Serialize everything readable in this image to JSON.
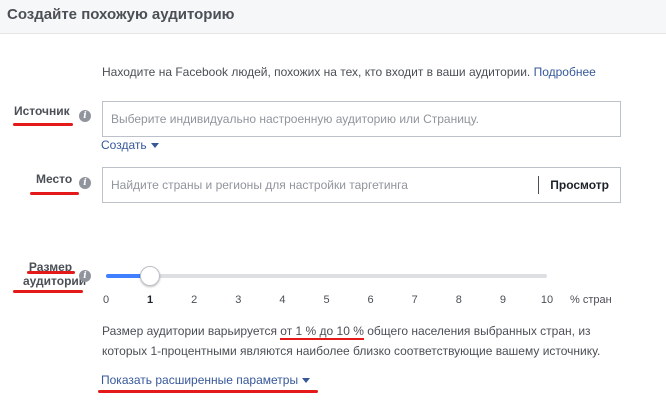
{
  "dialog": {
    "title": "Создайте похожую аудиторию"
  },
  "intro": {
    "text": "Находите на Facebook людей, похожих на тех, кто входит в ваши аудитории.",
    "link": "Подробнее"
  },
  "source": {
    "label": "Источник",
    "placeholder": "Выберите индивидуально настроенную аудиторию или Страницу.",
    "create_link": "Создать"
  },
  "location": {
    "label": "Место",
    "placeholder": "Найдите страны и регионы для настройки таргетинга",
    "browse_label": "Просмотр"
  },
  "audience_size": {
    "label_line1": "Размер",
    "label_line2": "аудитории",
    "ticks": [
      "0",
      "1",
      "2",
      "3",
      "4",
      "5",
      "6",
      "7",
      "8",
      "9",
      "10"
    ],
    "unit": "% стран",
    "selected_percent": 1,
    "max_percent": 10,
    "description_before": "Размер аудитории варьируется ",
    "description_range": "от 1 % до 10 %",
    "description_after": " общего населения выбранных стран, из которых 1-процентными являются наиболее близко соответствующие вашему источнику."
  },
  "advanced_link": "Показать расширенные параметры",
  "colors": {
    "link": "#365899",
    "accent": "#4080ff",
    "annotation": "#e41a1a"
  },
  "icons": {
    "info": "info-icon",
    "caret": "chevron-down-icon"
  }
}
